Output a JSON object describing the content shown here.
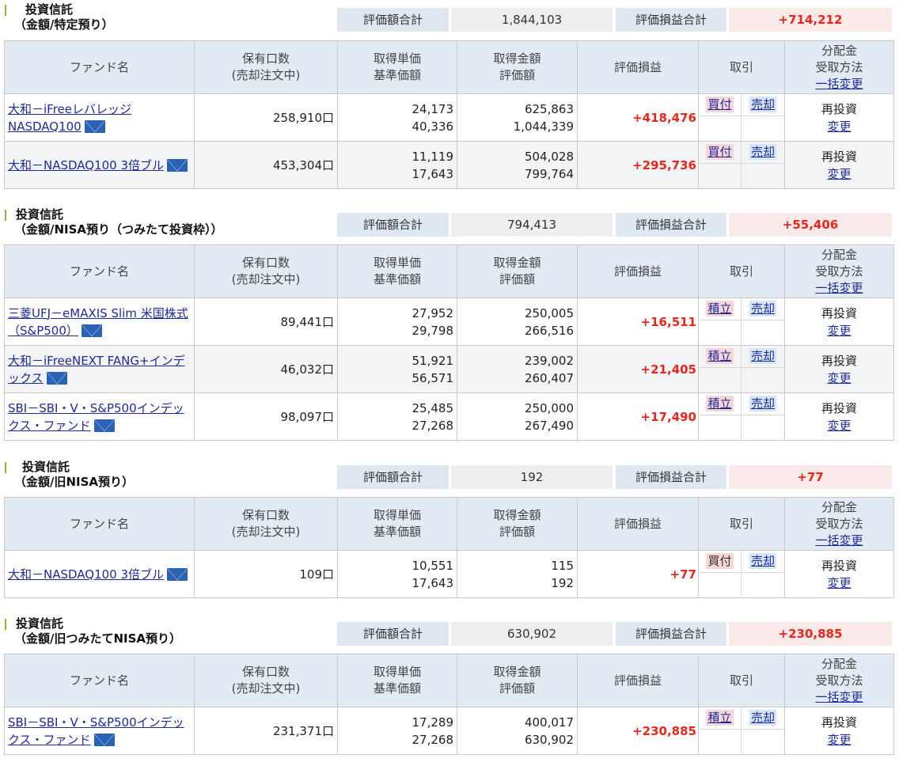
{
  "headers": {
    "fund_name": "ファンド名",
    "holding_1": "保有口数",
    "holding_2": "(売却注文中)",
    "unit_price_1": "取得単価",
    "unit_price_2": "基準価額",
    "amount_1": "取得金額",
    "amount_2": "評価額",
    "pl": "評価損益",
    "trade": "取引",
    "dist_1": "分配金",
    "dist_2": "受取方法",
    "dist_bulk_change": "一括変更"
  },
  "summary_labels": {
    "valuation_total": "評価額合計",
    "pl_total": "評価損益合計"
  },
  "labels": {
    "sell": "売却",
    "change": "変更"
  },
  "sections": [
    {
      "title_line1": "投資信託",
      "title_line2": "（金額/特定預り）",
      "valuation_total": "1,844,103",
      "pl_total": "+714,212",
      "funds": [
        {
          "name": "大和－iFreeレバレッジ NASDAQ100",
          "units": "258,910口",
          "unit_cost": "24,173",
          "nav": "40,336",
          "cost": "625,863",
          "value": "1,044,339",
          "pl": "+418,476",
          "buy_label": "買付",
          "dist_method": "再投資"
        },
        {
          "name": "大和－NASDAQ100 3倍ブル",
          "units": "453,304口",
          "unit_cost": "11,119",
          "nav": "17,643",
          "cost": "504,028",
          "value": "799,764",
          "pl": "+295,736",
          "buy_label": "買付",
          "dist_method": "再投資"
        }
      ]
    },
    {
      "title_line1": "投資信託",
      "title_line2": "（金額/NISA預り（つみたて投資枠））",
      "valuation_total": "794,413",
      "pl_total": "+55,406",
      "funds": [
        {
          "name": "三菱UFJ－eMAXIS Slim 米国株式（S&P500）",
          "units": "89,441口",
          "unit_cost": "27,952",
          "nav": "29,798",
          "cost": "250,005",
          "value": "266,516",
          "pl": "+16,511",
          "buy_label": "積立",
          "dist_method": "再投資"
        },
        {
          "name": "大和－iFreeNEXT FANG+インデックス",
          "units": "46,032口",
          "unit_cost": "51,921",
          "nav": "56,571",
          "cost": "239,002",
          "value": "260,407",
          "pl": "+21,405",
          "buy_label": "積立",
          "dist_method": "再投資"
        },
        {
          "name": "SBI－SBI・V・S&P500インデックス・ファンド",
          "units": "98,097口",
          "unit_cost": "25,485",
          "nav": "27,268",
          "cost": "250,000",
          "value": "267,490",
          "pl": "+17,490",
          "buy_label": "積立",
          "dist_method": "再投資"
        }
      ]
    },
    {
      "title_line1": "投資信託",
      "title_line2": "（金額/旧NISA預り）",
      "valuation_total": "192",
      "pl_total": "+77",
      "funds": [
        {
          "name": "大和－NASDAQ100 3倍ブル",
          "units": "109口",
          "unit_cost": "10,551",
          "nav": "17,643",
          "cost": "115",
          "value": "192",
          "pl": "+77",
          "buy_label": "買付",
          "dist_method": "再投資"
        }
      ]
    },
    {
      "title_line1": "投資信託",
      "title_line2": "（金額/旧つみたてNISA預り）",
      "valuation_total": "630,902",
      "pl_total": "+230,885",
      "funds": [
        {
          "name": "SBI－SBI・V・S&P500インデックス・ファンド",
          "units": "231,371口",
          "unit_cost": "17,289",
          "nav": "27,268",
          "cost": "400,017",
          "value": "630,902",
          "pl": "+230,885",
          "buy_label": "積立",
          "dist_method": "再投資"
        }
      ]
    }
  ]
}
